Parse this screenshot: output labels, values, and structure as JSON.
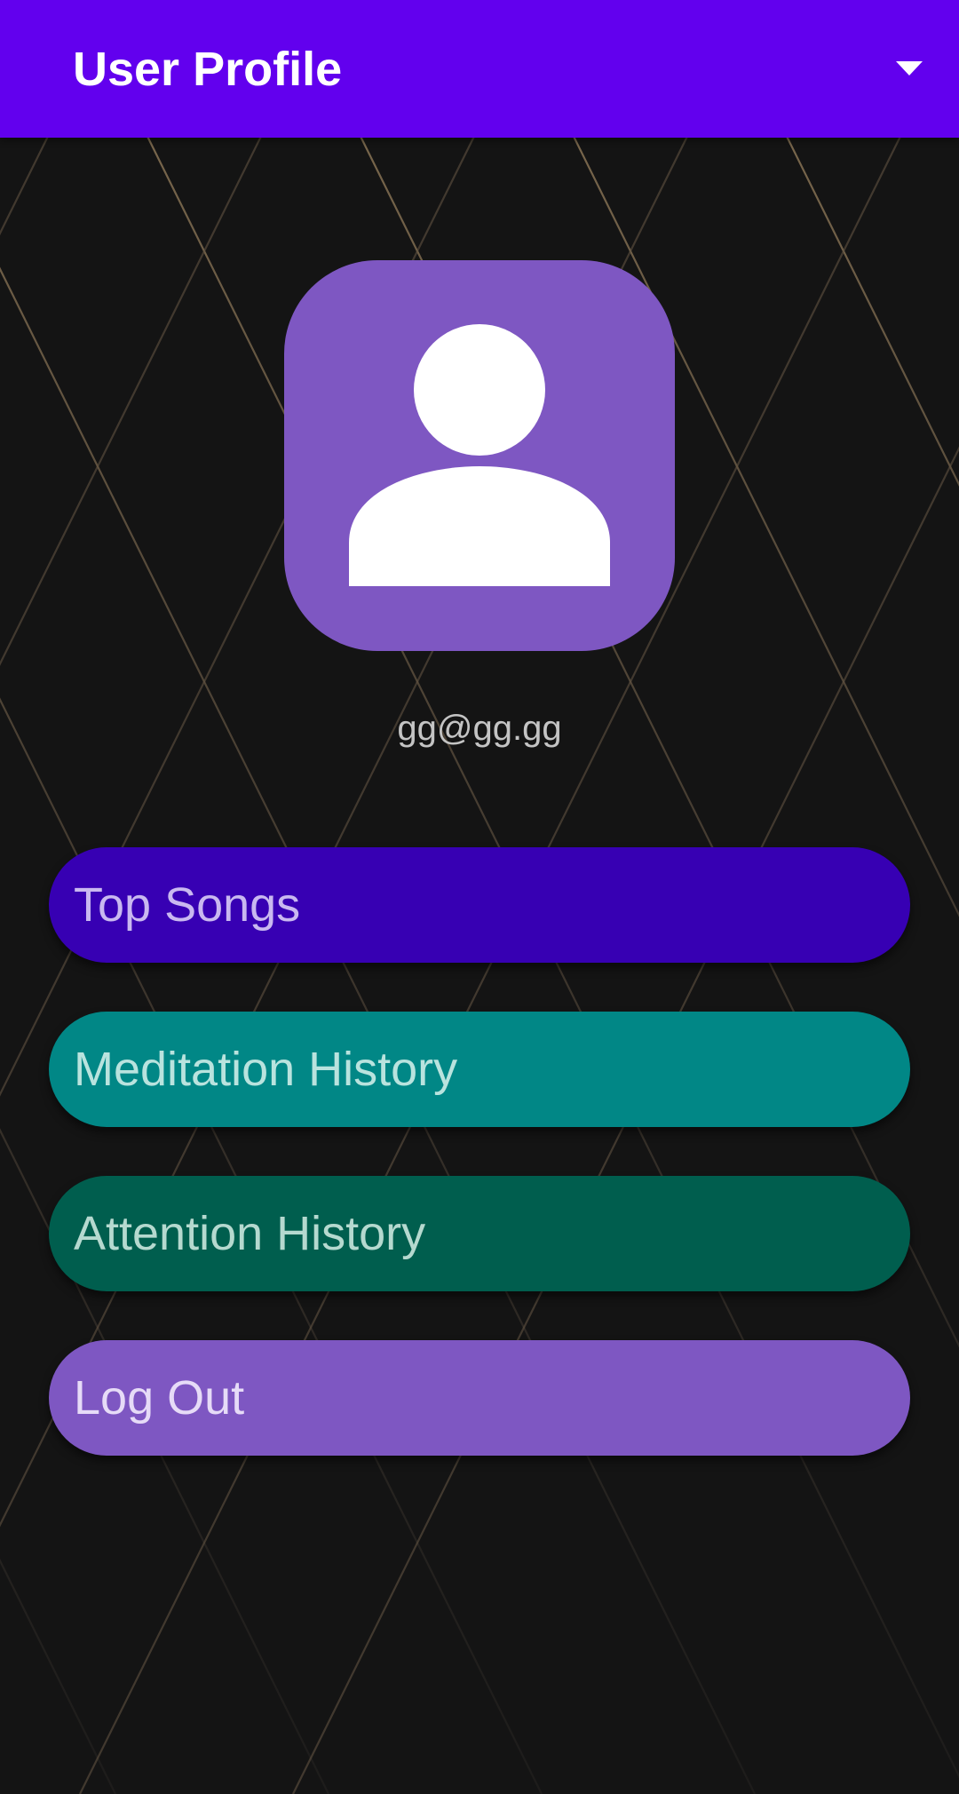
{
  "app_bar": {
    "title": "User Profile",
    "menu_icon": "arrow-drop-down-icon",
    "background": "#6200EE"
  },
  "profile": {
    "avatar_icon": "person-icon",
    "avatar_background": "#7E57C2",
    "email": "gg@gg.gg"
  },
  "actions": [
    {
      "label": "Top Songs",
      "background": "#3700B3",
      "text_color": "#C9B8F0"
    },
    {
      "label": "Meditation History",
      "background": "#018786",
      "text_color": "#B9E3DE"
    },
    {
      "label": "Attention History",
      "background": "#005E4E",
      "text_color": "#B5D9CF"
    },
    {
      "label": "Log Out",
      "background": "#7E57C2",
      "text_color": "#E6DBF7"
    }
  ],
  "background": {
    "base_color": "#141414",
    "line_color": "#6E5E45"
  }
}
